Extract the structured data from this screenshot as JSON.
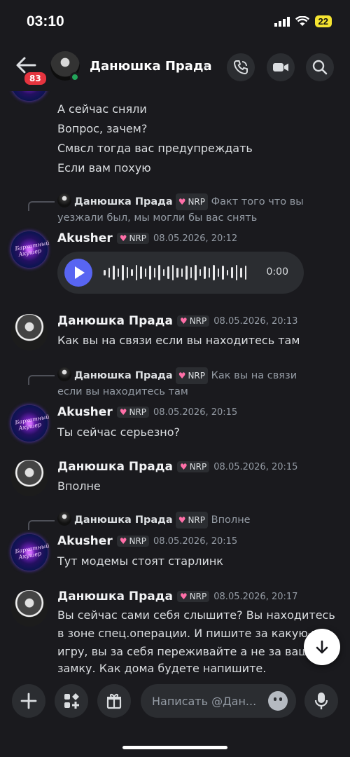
{
  "status": {
    "time": "03:10",
    "battery": "22"
  },
  "header": {
    "unread_badge": "83",
    "name": "Данюшка Прада",
    "chevron": "›"
  },
  "messages": {
    "continued_lines": [
      "А сейчас сняли",
      "Вопрос, зачем?",
      "Смвсл тогда вас предупреждать",
      "Если вам похую"
    ],
    "m1": {
      "reply": {
        "name": "Данюшка Прада",
        "tag": "NRP",
        "text": "Факт того что вы уезжали был, мы могли бы вас снять"
      },
      "author": "Akusher",
      "tag": "NRP",
      "time": "08.05.2026, 20:12",
      "voice": {
        "duration": "0:00"
      }
    },
    "m2": {
      "author": "Данюшка Прада",
      "tag": "NRP",
      "time": "08.05.2026, 20:13",
      "text": "Как вы на связи  если вы находитесь там"
    },
    "m3": {
      "reply": {
        "name": "Данюшка Прада",
        "tag": "NRP",
        "text": "Как вы на связи  если вы находитесь там"
      },
      "author": "Akusher",
      "tag": "NRP",
      "time": "08.05.2026, 20:15",
      "text": "Ты сейчас серьезно?"
    },
    "m4": {
      "author": "Данюшка Прада",
      "tag": "NRP",
      "time": "08.05.2026, 20:15",
      "text": "Вполне"
    },
    "m5": {
      "reply": {
        "name": "Данюшка Прада",
        "tag": "NRP",
        "text": "Вполне"
      },
      "author": "Akusher",
      "tag": "NRP",
      "time": "08.05.2026, 20:15",
      "text": "Тут модемы стоят старлинк"
    },
    "m6": {
      "author": "Данюшка Прада",
      "tag": "NRP",
      "time": "08.05.2026, 20:17",
      "lines": [
        "Вы сейчас сами себя слышите? Вы находитесь",
        "в зоне спец.операции. И пишите за какую-то",
        "игру, вы за себя переживайте а не за вашу",
        "замку. Как дома будете напишите."
      ]
    }
  },
  "avatar_text": "Бархатный Акушер",
  "composer": {
    "placeholder": "Написать @Дан..."
  },
  "colors": {
    "accent": "#5865f2",
    "online": "#23a55a",
    "badge": "#e5343f",
    "background": "#1a1a1e"
  },
  "icons": [
    "back-arrow-icon",
    "phone-icon",
    "video-icon",
    "search-icon",
    "plus-icon",
    "apps-icon",
    "gift-icon",
    "emoji-icon",
    "mic-icon",
    "arrow-down-icon",
    "heart-icon"
  ]
}
